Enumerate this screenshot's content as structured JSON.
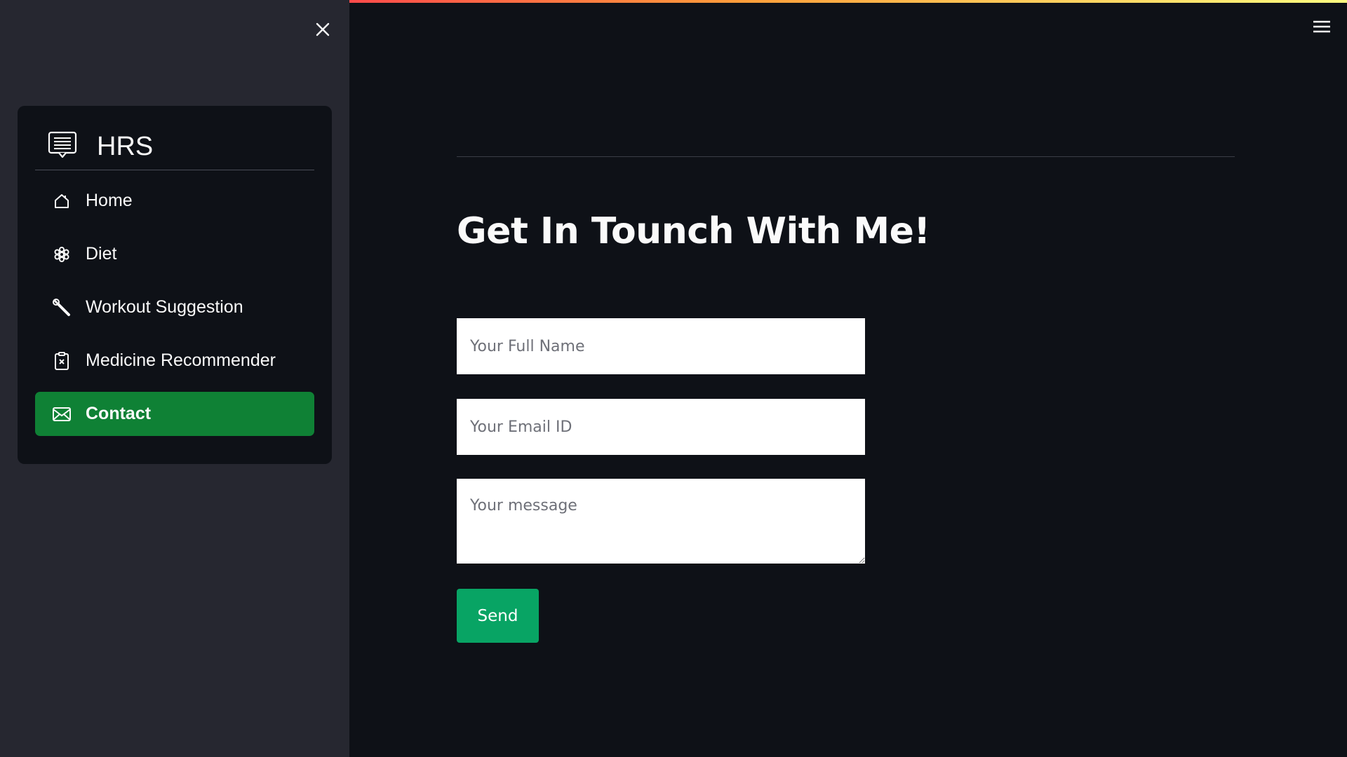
{
  "app": {
    "accent_gradient": [
      "#ff4b4b",
      "#ff9f3a",
      "#fffd80"
    ]
  },
  "sidebar": {
    "close_icon": "close-icon",
    "menu": {
      "title": "HRS",
      "title_icon": "list-card-icon",
      "items": [
        {
          "label": "Home",
          "icon": "house-icon",
          "active": false
        },
        {
          "label": "Diet",
          "icon": "snowflake-icon",
          "active": false
        },
        {
          "label": "Workout Suggestion",
          "icon": "wrench-icon",
          "active": false
        },
        {
          "label": "Medicine Recommender",
          "icon": "clipboard-x-icon",
          "active": false
        },
        {
          "label": "Contact",
          "icon": "envelope-icon",
          "active": true
        }
      ],
      "active_color": "#0f8135"
    }
  },
  "header": {
    "menu_icon": "hamburger-icon"
  },
  "main": {
    "heading": "Get In Tounch With Me!",
    "form": {
      "name": {
        "value": "",
        "placeholder": "Your Full Name"
      },
      "email": {
        "value": "",
        "placeholder": "Your Email ID"
      },
      "message": {
        "value": "",
        "placeholder": "Your message"
      },
      "send_label": "Send",
      "send_color": "#08a464"
    }
  }
}
